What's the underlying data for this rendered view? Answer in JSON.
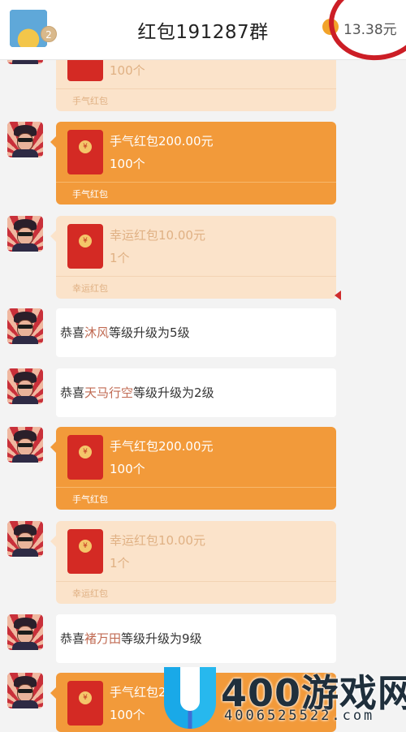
{
  "header": {
    "title": "红包191287群",
    "avatar_badge": "2",
    "balance": "13.38元",
    "annotation_color": "#cc1e26"
  },
  "colors": {
    "active_packet": "#f29a3a",
    "opened_packet": "#fbe3ca",
    "highlight_name": "#c06a52"
  },
  "messages": [
    {
      "kind": "red_packet",
      "state": "opened",
      "title": "",
      "count": "100个",
      "type": "手气红包"
    },
    {
      "kind": "red_packet",
      "state": "active",
      "title": "手气红包200.00元",
      "count": "100个",
      "type": "手气红包"
    },
    {
      "kind": "red_packet",
      "state": "opened",
      "title": "幸运红包10.00元",
      "count": "1个",
      "type": "幸运红包"
    },
    {
      "kind": "notice",
      "prefix": "恭喜",
      "name": "沐风",
      "suffix": "等级升级为5级"
    },
    {
      "kind": "notice",
      "prefix": "恭喜",
      "name": "天马行空",
      "suffix": "等级升级为2级"
    },
    {
      "kind": "red_packet",
      "state": "active",
      "title": "手气红包200.00元",
      "count": "100个",
      "type": "手气红包"
    },
    {
      "kind": "red_packet",
      "state": "opened",
      "title": "幸运红包10.00元",
      "count": "1个",
      "type": "幸运红包"
    },
    {
      "kind": "notice",
      "prefix": "恭喜",
      "name": "褚万田",
      "suffix": "等级升级为9级"
    },
    {
      "kind": "red_packet",
      "state": "active",
      "title": "手气红包200.00元",
      "count": "100个",
      "type": ""
    }
  ],
  "envelope_mark": "¥",
  "watermark": {
    "brand": "400游戏网",
    "url": "4006525522.com"
  }
}
